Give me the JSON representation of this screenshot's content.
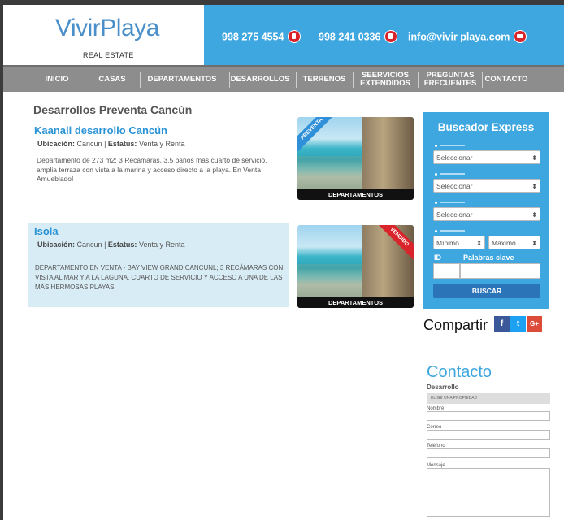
{
  "header": {
    "logo_main": "VivirPlaya",
    "logo_sub": "REAL ESTATE",
    "phone1": "998 275 4554",
    "phone2": "998 241 0336",
    "email": "info@vivir playa.com"
  },
  "nav": {
    "items": [
      "INICIO",
      "CASAS",
      "DEPARTAMENTOS",
      "DESARROLLOS",
      "TERRENOS",
      "SEERVICIOS EXTENDIDOS",
      "PREGUNTAS FRECUENTES",
      "CONTACTO"
    ]
  },
  "main": {
    "title": "Desarrollos Preventa Cancún",
    "properties": [
      {
        "title": "Kaanali desarrollo Cancún",
        "location_label": "Ubicación:",
        "location": "Cancun",
        "status_label": "Estatus:",
        "status": "Venta y Renta",
        "description": "Departamento de 273 m2: 3 Recámaras, 3.5 baños más cuarto de servicio, amplia terraza con vista a la marina y acceso directo a la playa. En Venta Amueblado!",
        "ribbon": "PREVENTA",
        "caption": "DEPARTAMENTOS"
      },
      {
        "title": "Isola",
        "location_label": "Ubicación:",
        "location": "Cancun",
        "status_label": "Estatus:",
        "status": "Venta y Renta",
        "description": "DEPARTAMENTO EN VENTA - BAY VIEW GRAND CANCUNL; 3 RECÁMARAS CON VISTA AL MAR Y A LA LAGUNA, CUARTO DE SERVICIO Y ACCESO A UNA DE LAS MÁS HERMOSAS PLAYAS!",
        "ribbon": "VENDIDO",
        "caption": "DEPARTAMENTOS"
      }
    ]
  },
  "buscador": {
    "title": "Buscador Express",
    "select1": "Seleccionar",
    "select2": "Seleccionar",
    "select3": "Seleccionar",
    "min": "Mínimo",
    "max": "Máximo",
    "id_label": "ID",
    "keywords_label": "Palabras clave",
    "search_button": "BUSCAR"
  },
  "share": {
    "label": "Compartir",
    "icons": [
      "facebook-icon",
      "twitter-icon",
      "google-plus-icon"
    ],
    "fb": "f",
    "tw": "t",
    "gp": "G+"
  },
  "contact_form": {
    "title": "Contacto",
    "desarrollo_label": "Desarrollo",
    "property_select": "ELIGE UNA PROPIEDAD",
    "name_label": "Nombre",
    "email_label": "Correo",
    "phone_label": "Teléfono",
    "message_label": "Mensaje"
  },
  "colors": {
    "accent_blue": "#3fa7e0",
    "nav_gray": "#8d8d8d",
    "red_icon": "#d8242a",
    "facebook": "#3b5998",
    "twitter": "#1da1f2",
    "google": "#dd4b39"
  }
}
